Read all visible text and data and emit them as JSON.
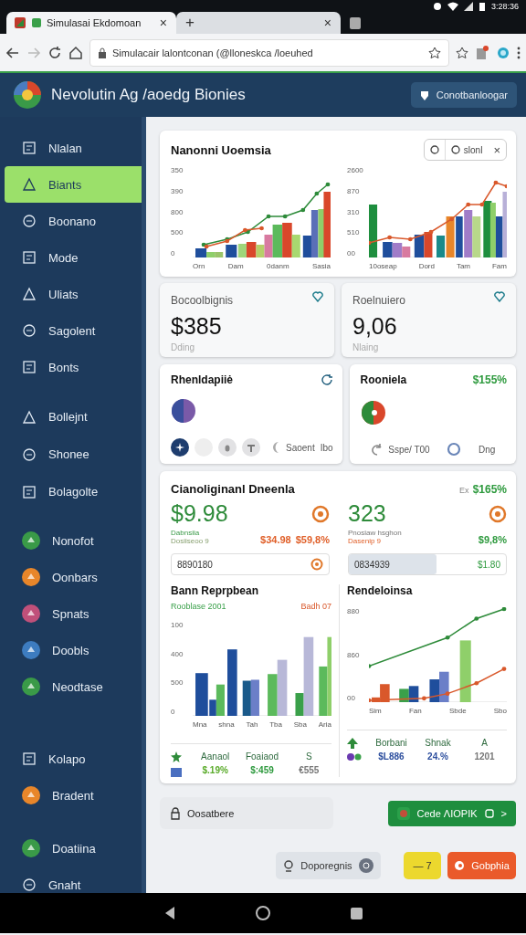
{
  "status_bar": {
    "time": "3:28:36"
  },
  "browser": {
    "tabs": [
      {
        "title": "Simulasai Ekdomoan",
        "close": "×",
        "selected": true
      },
      {
        "close": "×",
        "selected": false
      }
    ],
    "new_tab": "+",
    "url": "Simulacair lalontconan (@lloneskca /loeuhed"
  },
  "app_header": {
    "title": "Nevolutin Ag /aoedg Bionies",
    "button": "Conotbanloogar"
  },
  "sidebar": {
    "groups": [
      {
        "items": [
          {
            "label": "Nlalan",
            "kind": "line",
            "selected": false
          },
          {
            "label": "Biants",
            "kind": "line",
            "selected": true
          },
          {
            "label": "Boonano",
            "kind": "line",
            "selected": false
          },
          {
            "label": "Mode",
            "kind": "line",
            "selected": false
          },
          {
            "label": "Uliats",
            "kind": "line",
            "selected": false
          },
          {
            "label": "Sagolent",
            "kind": "line",
            "selected": false
          },
          {
            "label": "Bonts",
            "kind": "line",
            "selected": false
          }
        ]
      },
      {
        "items": [
          {
            "label": "Bollejnt",
            "kind": "line",
            "selected": false
          },
          {
            "label": "Shonee",
            "kind": "line",
            "selected": false
          },
          {
            "label": "Bolagolte",
            "kind": "line",
            "selected": false
          }
        ]
      },
      {
        "items": [
          {
            "label": "Nonofot",
            "kind": "dot",
            "color": "#3a9a48",
            "selected": false
          },
          {
            "label": "Oonbars",
            "kind": "dot",
            "color": "#e8862a",
            "selected": false
          },
          {
            "label": "Spnats",
            "kind": "dot",
            "color": "#c0507a",
            "selected": false
          },
          {
            "label": "Doobls",
            "kind": "dot",
            "color": "#3d7cc0",
            "selected": false
          },
          {
            "label": "Neodtase",
            "kind": "dot",
            "color": "#3a9a48",
            "selected": false
          }
        ]
      },
      {
        "items": [
          {
            "label": "Kolapo",
            "kind": "line",
            "selected": false
          },
          {
            "label": "Bradent",
            "kind": "dot",
            "color": "#e8862a",
            "selected": false
          }
        ]
      },
      {
        "items": [
          {
            "label": "Doatiina",
            "kind": "dot",
            "color": "#3a9a48",
            "selected": false
          },
          {
            "label": "Gnaht",
            "kind": "line",
            "selected": false
          }
        ]
      }
    ]
  },
  "usage_card": {
    "title": "Nanonni Uoemsia",
    "filter": {
      "option": "slonl",
      "close": "×"
    },
    "charts": [
      {
        "y_labels": [
          "350",
          "390",
          "800",
          "500",
          "0"
        ],
        "x_labels": [
          "Orn",
          "Dam",
          "0danm",
          "Sasia"
        ]
      },
      {
        "y_labels": [
          "2600",
          "870",
          "310",
          "510",
          "00"
        ],
        "x_labels": [
          "10oseap",
          "Dord",
          "Tam",
          "Fam"
        ]
      }
    ]
  },
  "stats": [
    {
      "title": "Bocoolbignis",
      "value": "$385",
      "caption": "Dding"
    },
    {
      "title": "Roelnuiero",
      "value": "9,06",
      "caption": "Nlaing"
    }
  ],
  "pie_cards": [
    {
      "kind": "controls",
      "title": "Rhenldapiiė",
      "labels": [
        "Saoent",
        "Ibo"
      ]
    },
    {
      "kind": "badge",
      "title": "Rooniela",
      "badge": "$155%",
      "labels": [
        "Sspe/ T00",
        "Dng"
      ]
    }
  ],
  "summary_card": {
    "title": "Cianoliginanl Dneenla",
    "badge_prefix": "Ex",
    "badge": "$165%",
    "metrics": [
      {
        "value": "$9.98",
        "caption": [
          "Dabnsiia",
          "Dosiiseoo 9"
        ],
        "changes": [
          "$34.98",
          "$59,8%"
        ],
        "color": "#e0602a",
        "field": {
          "value": "8890180"
        }
      },
      {
        "value": "323",
        "caption": [
          "Pnosiaw hsghon",
          "Dasenip 9"
        ],
        "changes": [
          "$9,8%"
        ],
        "color": "#2e9a3e",
        "field": {
          "value": "0834939",
          "amount": "$1.80"
        }
      }
    ],
    "charts": [
      {
        "title": "Bann Reprpbean",
        "legend": [
          "Rooblase 2001",
          "Badh 07"
        ],
        "y_labels": [
          "100",
          "400",
          "500",
          "0"
        ],
        "x_labels": [
          "Mna",
          "shna",
          "Tah",
          "Tba",
          "Sba",
          "Aria"
        ],
        "stats": [
          {
            "label": "Aanaol",
            "value": "$.19%",
            "color": "#5aab2a"
          },
          {
            "label": "Foaiaod",
            "value": "$:459",
            "color": "#2e9a3e"
          },
          {
            "label": "S",
            "value": "€555",
            "color": "#777777"
          }
        ]
      },
      {
        "title": "Rendeloinsa",
        "y_labels": [
          "880",
          "860",
          "00"
        ],
        "x_labels": [
          "Sim",
          "Fan",
          "Sbde",
          "Sbo"
        ],
        "stats": [
          {
            "label": "Borbani",
            "value": "$L886",
            "color": "#2d4f9e"
          },
          {
            "label": "Shnak",
            "value": "24.%",
            "color": "#2d4f9e"
          },
          {
            "label": "A",
            "value": "1201",
            "color": "#777777"
          }
        ]
      }
    ]
  },
  "footer_bar": {
    "label": "Oosatbere",
    "action": "Cede ΛΙΟΡΙΚ",
    "chevron": ">"
  },
  "actions": [
    {
      "label": "Doporegnis",
      "kind": "secondary"
    },
    {
      "label": "— 7",
      "kind": "warning"
    },
    {
      "label": "Gobphia",
      "kind": "danger"
    }
  ]
}
